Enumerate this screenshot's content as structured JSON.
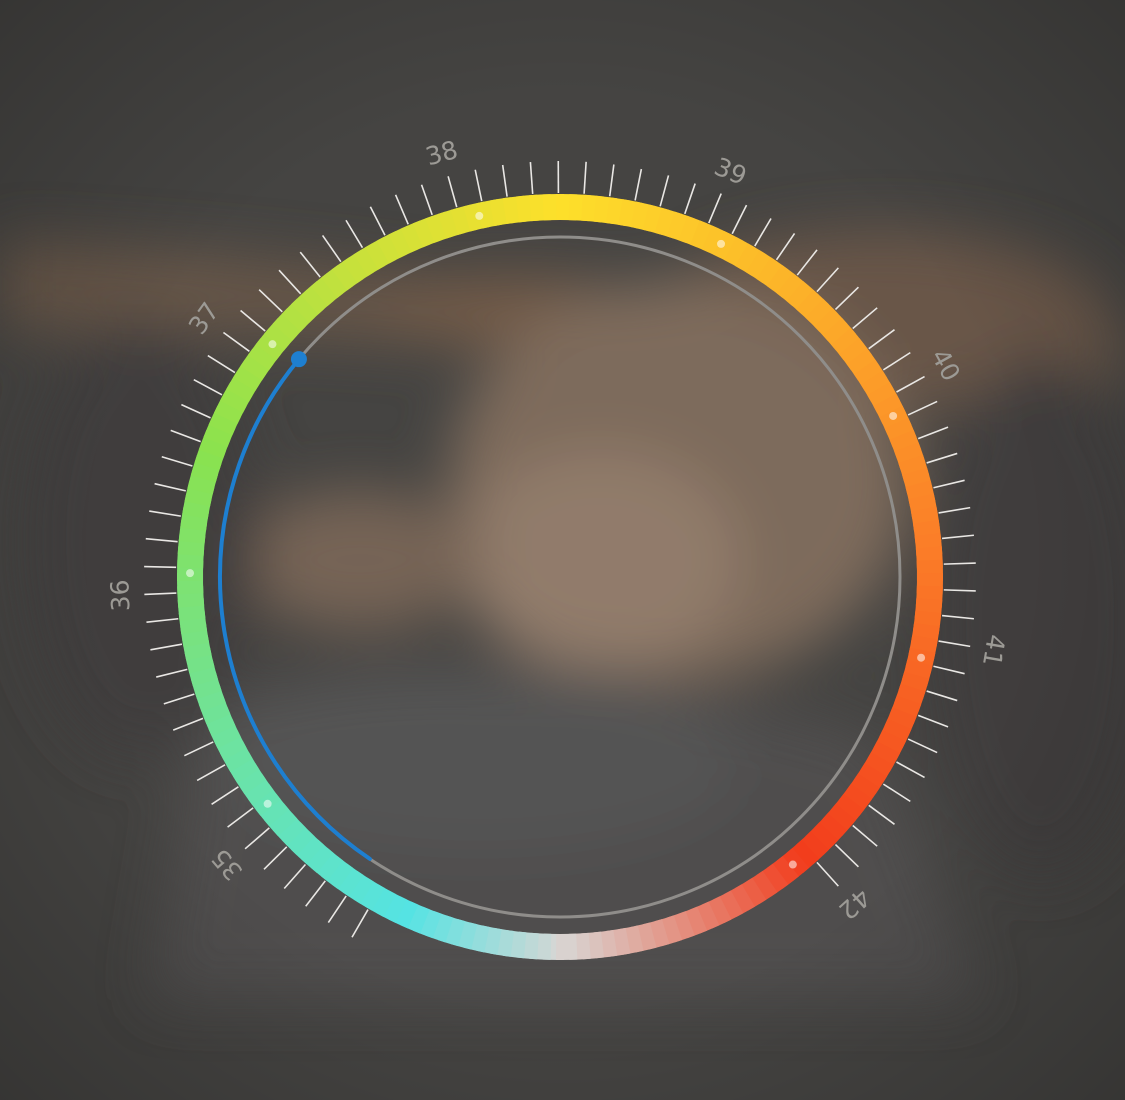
{
  "thermometer": {
    "scale_min": 34.5,
    "scale_max": 42,
    "labels": [
      "35",
      "36",
      "37",
      "38",
      "39",
      "40",
      "41",
      "42"
    ],
    "current_temperature": 37.1,
    "colors": {
      "cold": "#55e3e3",
      "cool": "#8ae24f",
      "warm": "#fde02a",
      "hot": "#fb7e28",
      "fever": "#f23c1c",
      "neutral": "#d8d6d4",
      "indicator": "#1e7fd0",
      "ticks": "#e9e7e4",
      "labels": "#9c9a95",
      "inner_ring": "#8f8d8a"
    }
  }
}
